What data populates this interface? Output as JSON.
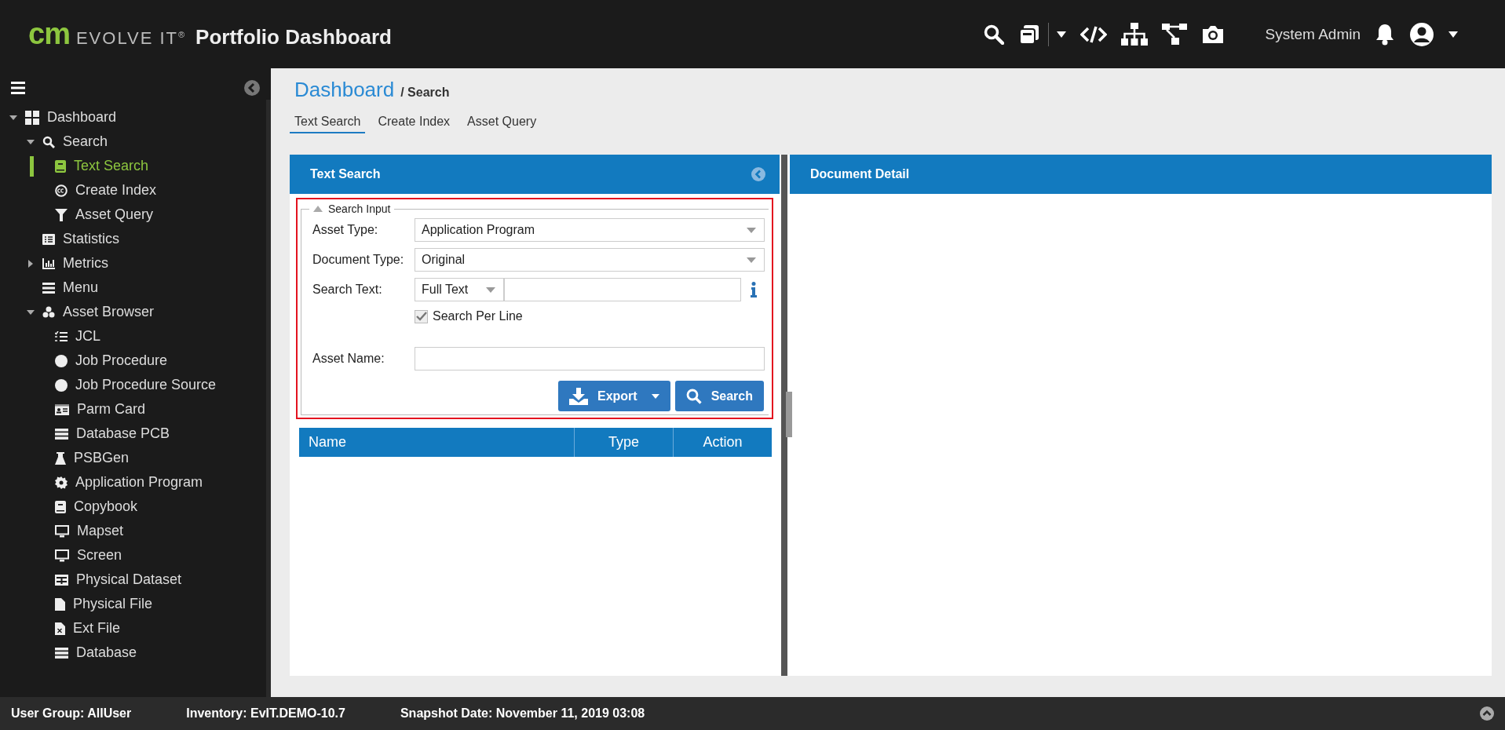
{
  "header": {
    "logo_mark": "cm",
    "logo_text": "EVOLVE IT$^{®}$",
    "title": "Portfolio Dashboard",
    "user": "System Admin"
  },
  "sidebar": {
    "items": [
      {
        "label": "Dashboard",
        "selected": false,
        "expanded": true,
        "children": [
          {
            "label": "Search",
            "selected": false,
            "expanded": true,
            "children": [
              {
                "label": "Text Search",
                "selected": true
              },
              {
                "label": "Create Index",
                "selected": false
              },
              {
                "label": "Asset Query",
                "selected": false
              }
            ]
          },
          {
            "label": "Statistics",
            "selected": false
          },
          {
            "label": "Metrics",
            "selected": false,
            "expanded": false
          },
          {
            "label": "Menu",
            "selected": false
          },
          {
            "label": "Asset Browser",
            "selected": false,
            "expanded": true,
            "children": [
              {
                "label": "JCL",
                "selected": false
              },
              {
                "label": "Job Procedure",
                "selected": false
              },
              {
                "label": "Job Procedure Source",
                "selected": false
              },
              {
                "label": "Parm Card",
                "selected": false
              },
              {
                "label": "Database PCB",
                "selected": false
              },
              {
                "label": "PSBGen",
                "selected": false
              },
              {
                "label": "Application Program",
                "selected": false
              },
              {
                "label": "Copybook",
                "selected": false
              },
              {
                "label": "Mapset",
                "selected": false
              },
              {
                "label": "Screen",
                "selected": false
              },
              {
                "label": "Physical Dataset",
                "selected": false
              },
              {
                "label": "Physical File",
                "selected": false
              },
              {
                "label": "Ext File",
                "selected": false
              },
              {
                "label": "Database",
                "selected": false
              }
            ]
          }
        ]
      }
    ]
  },
  "breadcrumb": {
    "root": "Dashboard",
    "current": "/ Search"
  },
  "tabs": [
    {
      "label": "Text Search",
      "selected": true
    },
    {
      "label": "Create Index",
      "selected": false
    },
    {
      "label": "Asset Query",
      "selected": false
    }
  ],
  "left_panel": {
    "title": "Text Search",
    "group_title": "Search Input",
    "asset_type": {
      "label": "Asset Type:",
      "value": "Application Program"
    },
    "document_type": {
      "label": "Document Type:",
      "value": "Original"
    },
    "search_text": {
      "label": "Search Text:",
      "mode": "Full Text"
    },
    "search_per_line": {
      "label": "Search Per Line",
      "checked": true
    },
    "asset_name": {
      "label": "Asset Name:"
    },
    "buttons": {
      "export": "Export",
      "search": "Search"
    },
    "table": {
      "columns": [
        "Name",
        "Type",
        "Action"
      ]
    }
  },
  "right_panel": {
    "title": "Document Detail"
  },
  "status_bar": [
    "User Group: AllUser",
    "Inventory: EvIT.DEMO-10.7",
    "Snapshot Date: November 11, 2019 03:08"
  ]
}
